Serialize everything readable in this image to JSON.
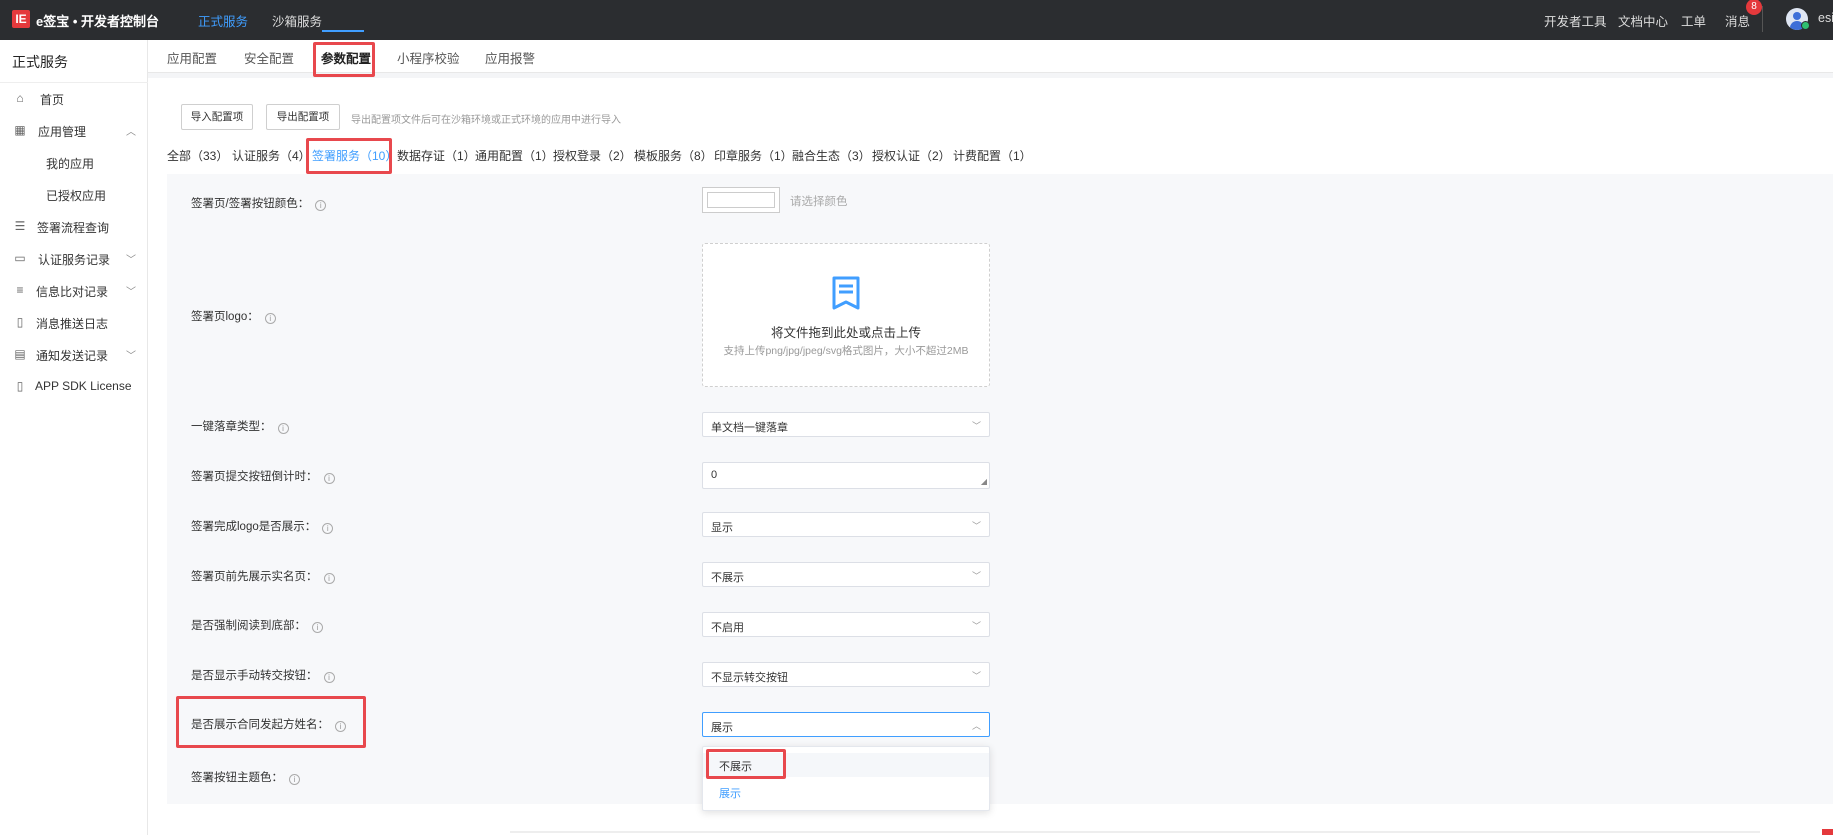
{
  "topbar": {
    "logo_mark": "IE",
    "logo_text": "e签宝 • 开发者控制台",
    "nav": [
      "正式服务",
      "沙箱服务"
    ],
    "right": [
      "开发者工具",
      "文档中心",
      "工单",
      "消息"
    ],
    "message_count": "8",
    "user": "esi"
  },
  "sidebar": {
    "title": "正式服务",
    "items": [
      {
        "label": "首页",
        "icon": "home-icon"
      },
      {
        "label": "应用管理",
        "icon": "apps-icon"
      },
      {
        "label": "我的应用"
      },
      {
        "label": "已授权应用"
      },
      {
        "label": "签署流程查询",
        "icon": "flow-icon"
      },
      {
        "label": "认证服务记录",
        "icon": "id-card-icon"
      },
      {
        "label": "信息比对记录",
        "icon": "compare-icon"
      },
      {
        "label": "消息推送日志",
        "icon": "log-icon"
      },
      {
        "label": "通知发送记录",
        "icon": "notify-icon"
      },
      {
        "label": "APP SDK License",
        "icon": "book-icon"
      }
    ]
  },
  "tabs": [
    "应用配置",
    "安全配置",
    "参数配置",
    "小程序校验",
    "应用报警"
  ],
  "actions": {
    "import_label": "导入配置项",
    "export_label": "导出配置项",
    "hint": "导出配置项文件后可在沙箱环境或正式环境的应用中进行导入"
  },
  "categories": [
    "全部（33）",
    "认证服务（4）",
    "签署服务（10）",
    "数据存证（1）",
    "通用配置（1）",
    "授权登录（2）",
    "模板服务（8）",
    "印章服务（1）",
    "融合生态（3）",
    "授权认证（2）",
    "计费配置（1）"
  ],
  "form": {
    "color_label": "签署页/签署按钮颜色：",
    "color_placeholder": "请选择颜色",
    "logo_label": "签署页logo：",
    "upload_text": "将文件拖到此处或点击上传",
    "upload_sub": "支持上传png/jpg/jpeg/svg格式图片，大小不超过2MB",
    "seal_label": "一键落章类型：",
    "seal_value": "单文档一键落章",
    "countdown_label": "签署页提交按钮倒计时：",
    "countdown_value": "0",
    "finish_logo_label": "签署完成logo是否展示：",
    "finish_logo_value": "显示",
    "realname_label": "签署页前先展示实名页：",
    "realname_value": "不展示",
    "force_read_label": "是否强制阅读到底部：",
    "force_read_value": "不启用",
    "transfer_label": "是否显示手动转交按钮：",
    "transfer_value": "不显示转交按钮",
    "initiator_label": "是否展示合同发起方姓名：",
    "initiator_value": "展示",
    "theme_label": "签署按钮主题色："
  },
  "dropdown_options": [
    "不展示",
    "展示"
  ],
  "colors": {
    "accent": "#409eff",
    "topbar": "#2b2d30",
    "highlight": "#e8484d"
  }
}
